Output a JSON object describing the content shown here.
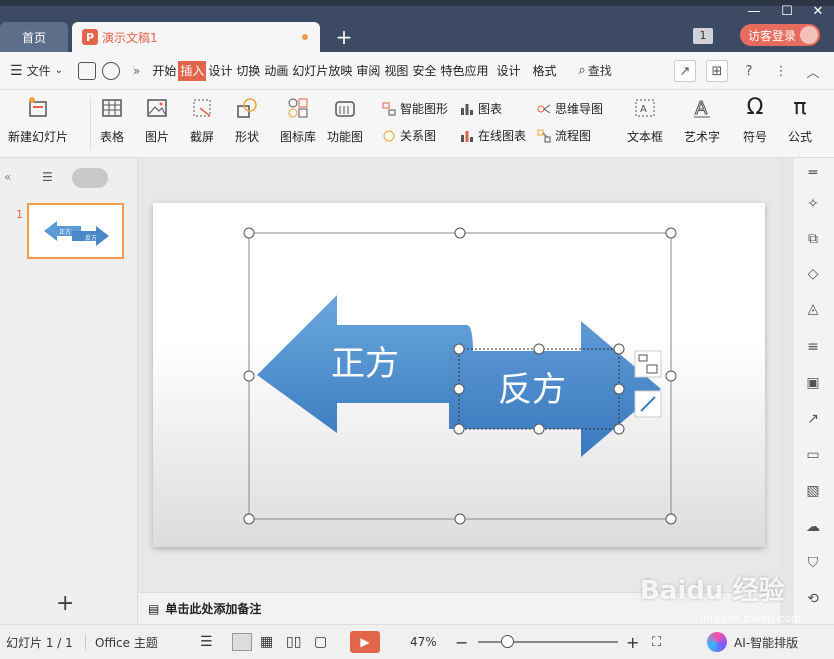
{
  "tabs": {
    "home": "首页",
    "document": "演示文稿1",
    "add": "+"
  },
  "window": {
    "badge": "1",
    "login": "访客登录"
  },
  "menu": {
    "file": "文件",
    "items": [
      "开始",
      "插入",
      "设计",
      "切换",
      "动画",
      "幻灯片放映",
      "审阅",
      "视图",
      "安全",
      "特色应用",
      "设计",
      "格式"
    ],
    "active_index": 1,
    "search": "查找"
  },
  "ribbon": {
    "new_slide": "新建幻灯片",
    "table": "表格",
    "picture": "图片",
    "screenshot": "截屏",
    "shape": "形状",
    "icon_library": "图标库",
    "function_chart": "功能图",
    "smart_graphic": "智能图形",
    "chart": "图表",
    "mindmap": "思维导图",
    "relation": "关系图",
    "online_chart": "在线图表",
    "flowchart": "流程图",
    "textbox": "文本框",
    "wordart": "艺术字",
    "symbol": "符号",
    "formula": "公式",
    "omega": "Ω",
    "pi": "π"
  },
  "slide": {
    "left_arrow_text": "正方",
    "right_arrow_text": "反方",
    "thumb_left": "正方",
    "thumb_right": "反方",
    "thumb_number": "1"
  },
  "notes": {
    "placeholder": "单击此处添加备注"
  },
  "status": {
    "slide_counter": "幻灯片 1 / 1",
    "theme": "Office 主题",
    "zoom": "47%",
    "ai_layout": "AI-智能排版"
  },
  "watermark": {
    "brand": "Baidu 经验",
    "url": "jingyan.baidu.com"
  },
  "colors": {
    "accent": "#e2644b",
    "arrow_blue": "#5b9bd5",
    "title_bar": "#3c4b63"
  }
}
